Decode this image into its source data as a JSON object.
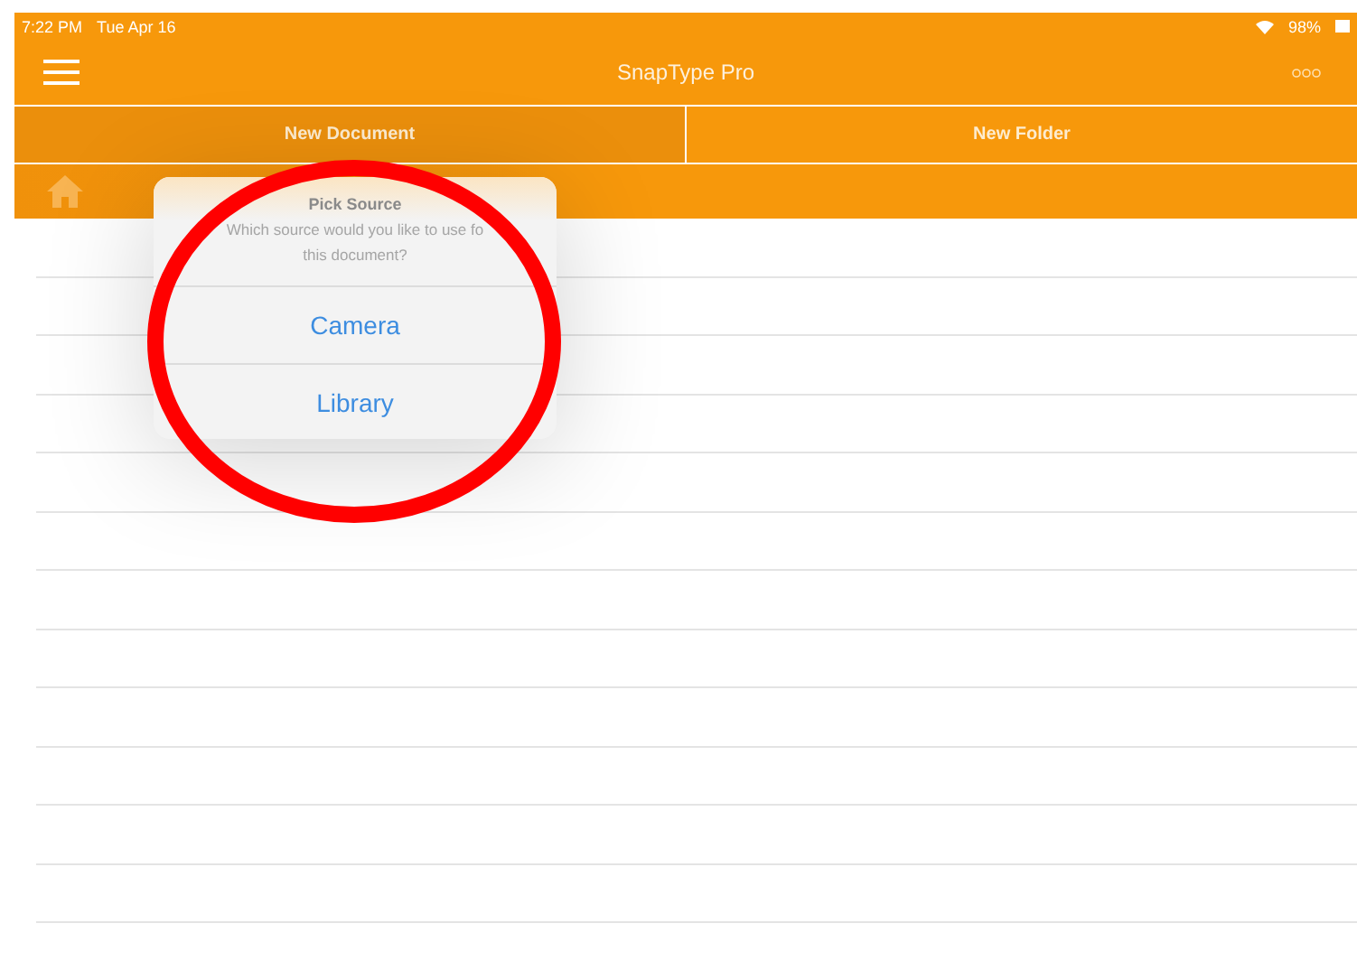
{
  "status_bar": {
    "time": "7:22 PM",
    "date": "Tue Apr 16",
    "battery": "98%"
  },
  "nav_bar": {
    "title": "SnapType Pro"
  },
  "tabs": [
    {
      "label": "New Document",
      "selected": true
    },
    {
      "label": "New Folder",
      "selected": false
    }
  ],
  "popover": {
    "title": "Pick Source",
    "message_lines": [
      "Which source would you like to use fo",
      "this document?"
    ],
    "actions": [
      "Camera",
      "Library"
    ]
  }
}
